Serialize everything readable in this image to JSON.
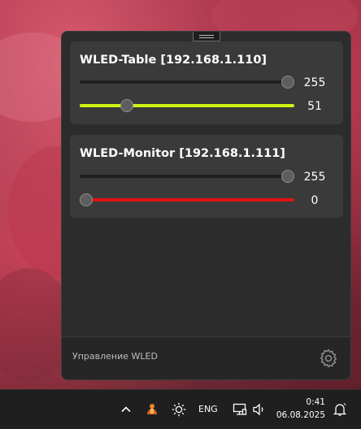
{
  "panel": {
    "devices": [
      {
        "title": "WLED-Table [192.168.1.110]",
        "brightness": {
          "value": "255",
          "fraction": 1.0,
          "color": "#1f1f1f"
        },
        "effect": {
          "value": "51",
          "fraction": 0.2,
          "color": "#ccf512"
        }
      },
      {
        "title": "WLED-Monitor [192.168.1.111]",
        "brightness": {
          "value": "255",
          "fraction": 1.0,
          "color": "#1f1f1f"
        },
        "effect": {
          "value": "0",
          "fraction": 0.0,
          "color": "#e01414"
        }
      }
    ],
    "footer_label": "Управление WLED",
    "settings_icon": "gear-icon"
  },
  "taskbar": {
    "icons": [
      "chevron-up-icon",
      "app-tray-icon",
      "brightness-icon",
      "network-icon",
      "volume-icon",
      "notification-bell-icon"
    ],
    "language": "ENG",
    "time": "0:41",
    "date": "06.08.2025"
  }
}
